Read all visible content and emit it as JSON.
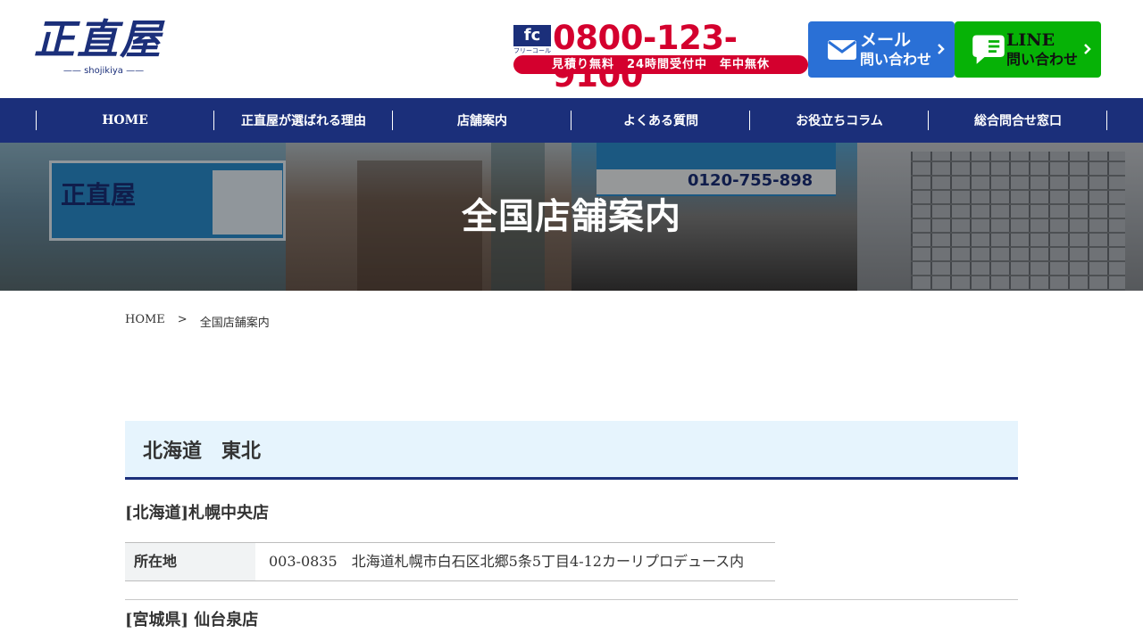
{
  "header": {
    "logo_main": "正直屋",
    "logo_sub": "—— shojikiya ——",
    "freecall_mark": "fc",
    "freecall_label": "フリーコール",
    "phone": "0800-123-9100",
    "phone_note": "見積り無料　24時間受付中　年中無休",
    "mail_button": {
      "line1": "メール",
      "line2": "問い合わせ",
      "icon": "envelope-icon",
      "color": "#2a70d6"
    },
    "line_button": {
      "line1": "LINE",
      "line2": "問い合わせ",
      "icon": "chat-bubble-icon",
      "color": "#06b206"
    }
  },
  "nav": {
    "items": [
      {
        "label": "HOME"
      },
      {
        "label": "正直屋が選ばれる理由"
      },
      {
        "label": "店舗案内"
      },
      {
        "label": "よくある質問"
      },
      {
        "label": "お役立ちコラム"
      },
      {
        "label": "総合問合せ窓口"
      }
    ],
    "color": "#1b2f7a"
  },
  "hero": {
    "title": "全国店舗案内",
    "sign1_text": "正直屋",
    "sign3_tel": "0120-755-898"
  },
  "breadcrumb": {
    "home": "HOME",
    "separator": ">",
    "current": "全国店舗案内"
  },
  "region": {
    "title": "北海道　東北"
  },
  "stores": [
    {
      "name": "[北海道]札幌中央店",
      "address_label": "所在地",
      "address": "003-0835　北海道札幌市白石区北郷5条5丁目4-12カーリプロデュース内"
    },
    {
      "name": "[宮城県] 仙台泉店"
    }
  ]
}
